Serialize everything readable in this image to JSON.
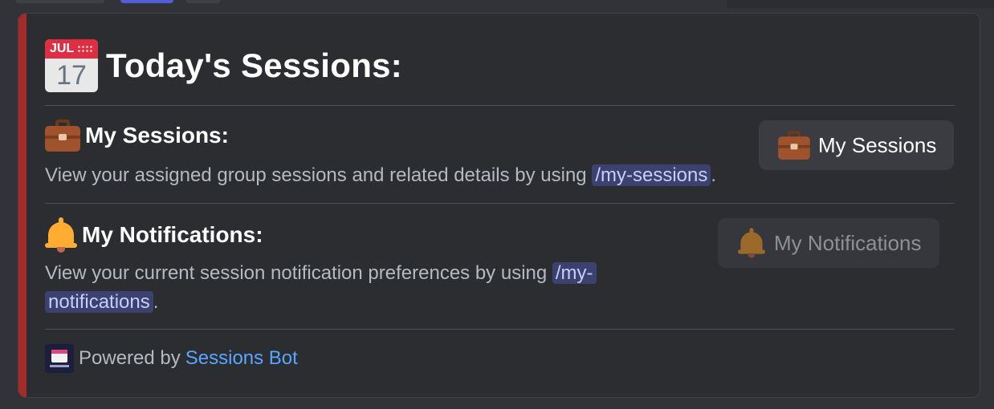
{
  "embed": {
    "title_icon": "calendar-icon",
    "calendar_month": "JUL",
    "calendar_day": "17",
    "title": "Today's Sessions:",
    "accent_color": "#a52a2a",
    "sections": [
      {
        "icon": "briefcase-icon",
        "heading": "My Sessions:",
        "desc_prefix": "View your assigned group sessions and related details by using",
        "command": "/my-sessions",
        "desc_suffix": "."
      },
      {
        "icon": "bell-icon",
        "heading": "My Notifications:",
        "desc_prefix": "View your current session notification preferences by using",
        "command_part1": "/my-",
        "command_part2": "notifications",
        "desc_suffix": "."
      }
    ],
    "footer": {
      "prefix": "Powered by",
      "link": "Sessions Bot"
    }
  },
  "buttons": {
    "my_sessions": {
      "label": "My Sessions",
      "icon": "briefcase-icon",
      "enabled": true
    },
    "my_notifications": {
      "label": "My Notifications",
      "icon": "bell-icon",
      "enabled": false
    }
  }
}
